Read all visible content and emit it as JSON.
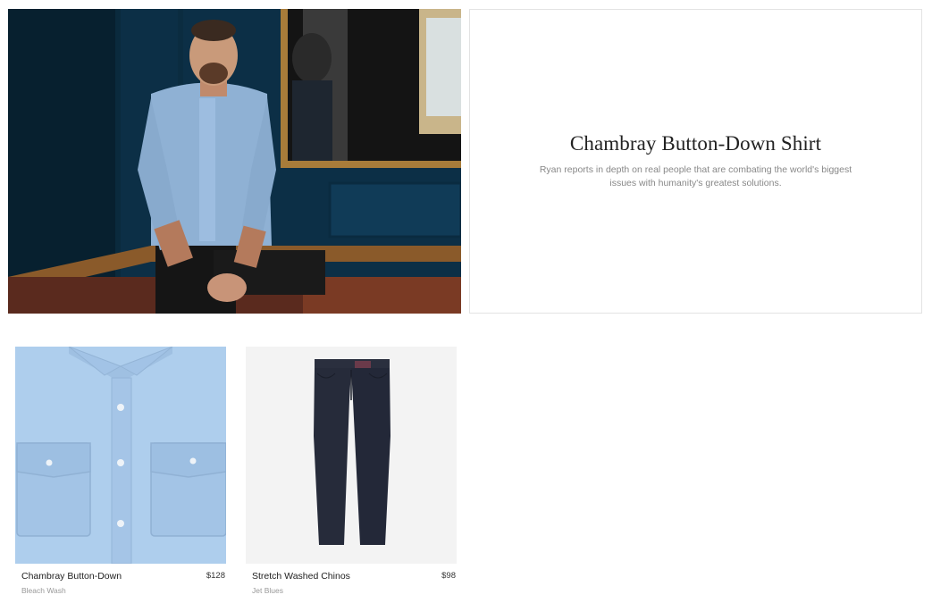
{
  "hero": {
    "title": "Chambray Button-Down Shirt",
    "description": "Ryan reports in depth on real people that are combating the world's biggest issues with humanity's greatest solutions."
  },
  "products": [
    {
      "name": "Chambray Button-Down",
      "variant": "Bleach Wash",
      "price": "$128"
    },
    {
      "name": "Stretch Washed Chinos",
      "variant": "Jet Blues",
      "price": "$98"
    }
  ],
  "colors": {
    "hero_wall": "#0e3a55",
    "shirt_blue": "#a9c8e8",
    "chinos_navy": "#262b3a",
    "card_border": "#e3e3e3"
  }
}
